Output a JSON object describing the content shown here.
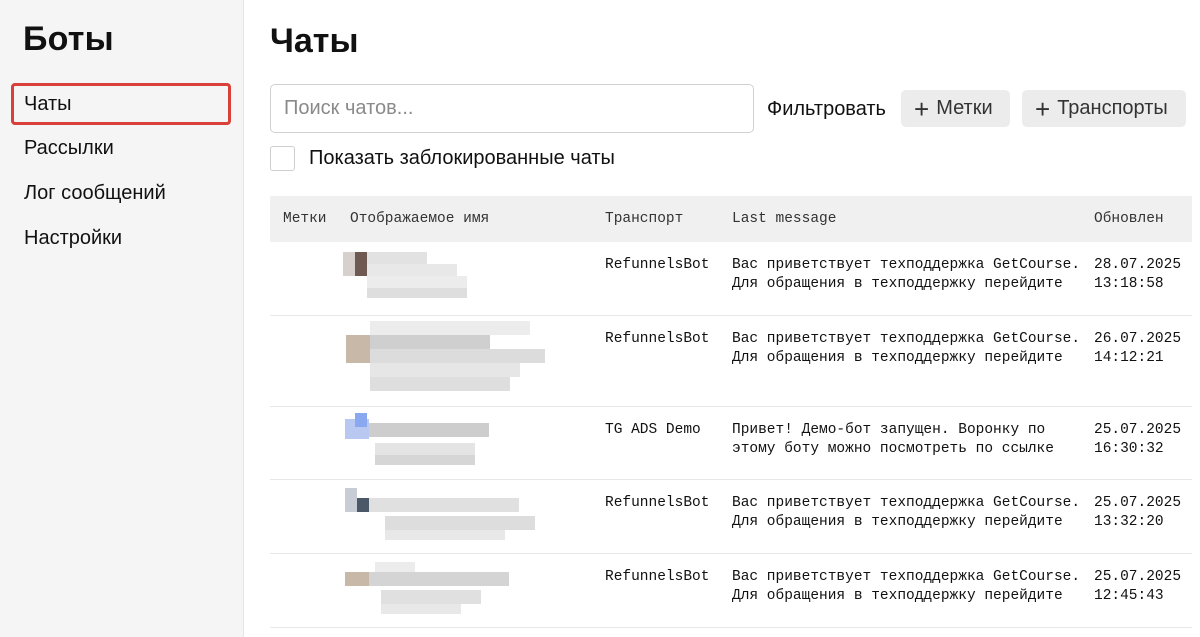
{
  "sidebar": {
    "title": "Боты",
    "items": [
      {
        "label": "Чаты",
        "active": true
      },
      {
        "label": "Рассылки",
        "active": false
      },
      {
        "label": "Лог сообщений",
        "active": false
      },
      {
        "label": "Настройки",
        "active": false
      }
    ]
  },
  "main": {
    "title": "Чаты",
    "search_placeholder": "Поиск чатов...",
    "filter_label": "Фильтровать",
    "labels_button": "Метки",
    "transports_button": "Транспорты",
    "show_blocked_label": "Показать заблокированные чаты",
    "show_blocked_checked": false
  },
  "table": {
    "headers": {
      "labels": "Метки",
      "name": "Отображаемое имя",
      "transport": "Транспорт",
      "message": "Last message",
      "updated": "Обновлен"
    },
    "rows": [
      {
        "transport": "RefunnelsBot",
        "message_line1": "Вас приветствует техподдержка GetCourse.",
        "message_line2": "Для обращения в техподдержку перейдите",
        "date": "28.07.2025",
        "time": "13:18:58"
      },
      {
        "transport": "RefunnelsBot",
        "message_line1": "Вас приветствует техподдержка GetCourse.",
        "message_line2": "Для обращения в техподдержку перейдите",
        "date": "26.07.2025",
        "time": "14:12:21"
      },
      {
        "transport": "TG ADS Demo",
        "message_line1": "Привет! Демо-бот запущен. Воронку по",
        "message_line2": "этому боту можно посмотреть по ссылке",
        "date": "25.07.2025",
        "time": "16:30:32"
      },
      {
        "transport": "RefunnelsBot",
        "message_line1": "Вас приветствует техподдержка GetCourse.",
        "message_line2": "Для обращения в техподдержку перейдите",
        "date": "25.07.2025",
        "time": "13:32:20"
      },
      {
        "transport": "RefunnelsBot",
        "message_line1": "Вас приветствует техподдержка GetCourse.",
        "message_line2": "Для обращения в техподдержку перейдите",
        "date": "25.07.2025",
        "time": "12:45:43"
      }
    ]
  },
  "colors": {
    "active_outline": "#d9403a",
    "sidebar_bg": "#f5f5f5",
    "header_bg": "#f0f0f0",
    "button_bg": "#ececec"
  },
  "icons": {
    "add": "plus-icon"
  }
}
